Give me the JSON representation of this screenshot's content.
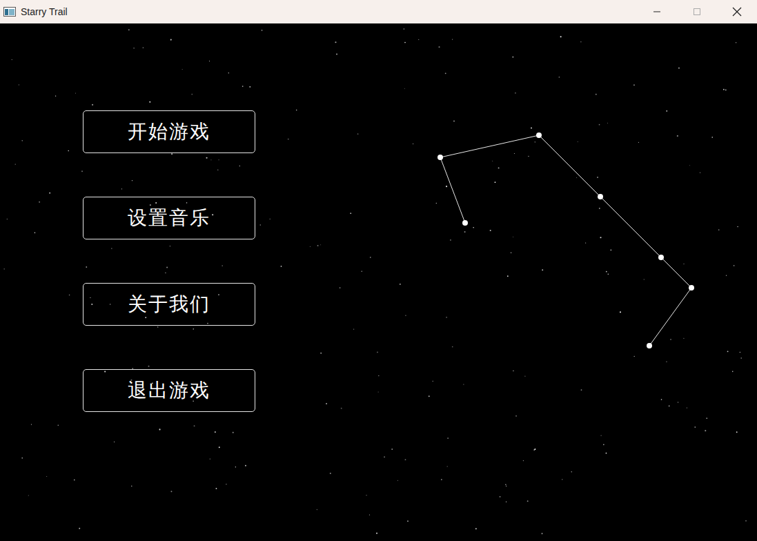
{
  "window": {
    "title": "Starry Trail"
  },
  "menu": {
    "buttons": [
      {
        "label": "开始游戏"
      },
      {
        "label": "设置音乐"
      },
      {
        "label": "关于我们"
      },
      {
        "label": "退出游戏"
      }
    ]
  }
}
